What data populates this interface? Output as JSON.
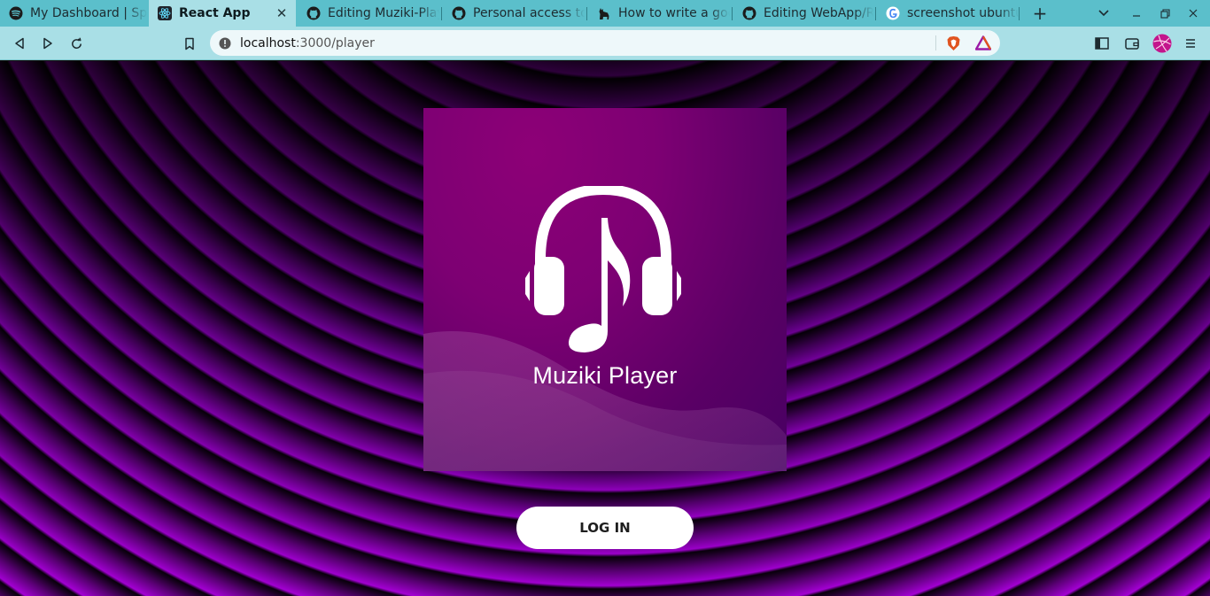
{
  "browser": {
    "tabs": [
      {
        "title": "My Dashboard | Sp",
        "favicon": "spotify-icon",
        "active": false
      },
      {
        "title": "React App",
        "favicon": "react-icon",
        "active": true
      },
      {
        "title": "Editing Muziki-Play",
        "favicon": "github-icon",
        "active": false
      },
      {
        "title": "Personal access to",
        "favicon": "github-icon",
        "active": false
      },
      {
        "title": "How to write a goo",
        "favicon": "llama-icon",
        "active": false
      },
      {
        "title": "Editing WebApp/R",
        "favicon": "github-icon",
        "active": false
      },
      {
        "title": "screenshot ubuntu",
        "favicon": "google-icon",
        "active": false
      }
    ],
    "new_tab_label": "+",
    "address": {
      "host": "localhost",
      "path": ":3000/player"
    },
    "colors": {
      "tabstrip": "#5bbfcb",
      "toolbar": "#a9dfe6",
      "accent": "#e0531f"
    }
  },
  "app": {
    "brand_name": "Muziki Player",
    "logo_icon": "headphones-music-note-icon",
    "login_label": "LOG IN",
    "colors": {
      "ring_dark": "#0b0010",
      "ring_light": "#a200d2",
      "card": "#7d0073",
      "button": "#ffffff"
    }
  }
}
